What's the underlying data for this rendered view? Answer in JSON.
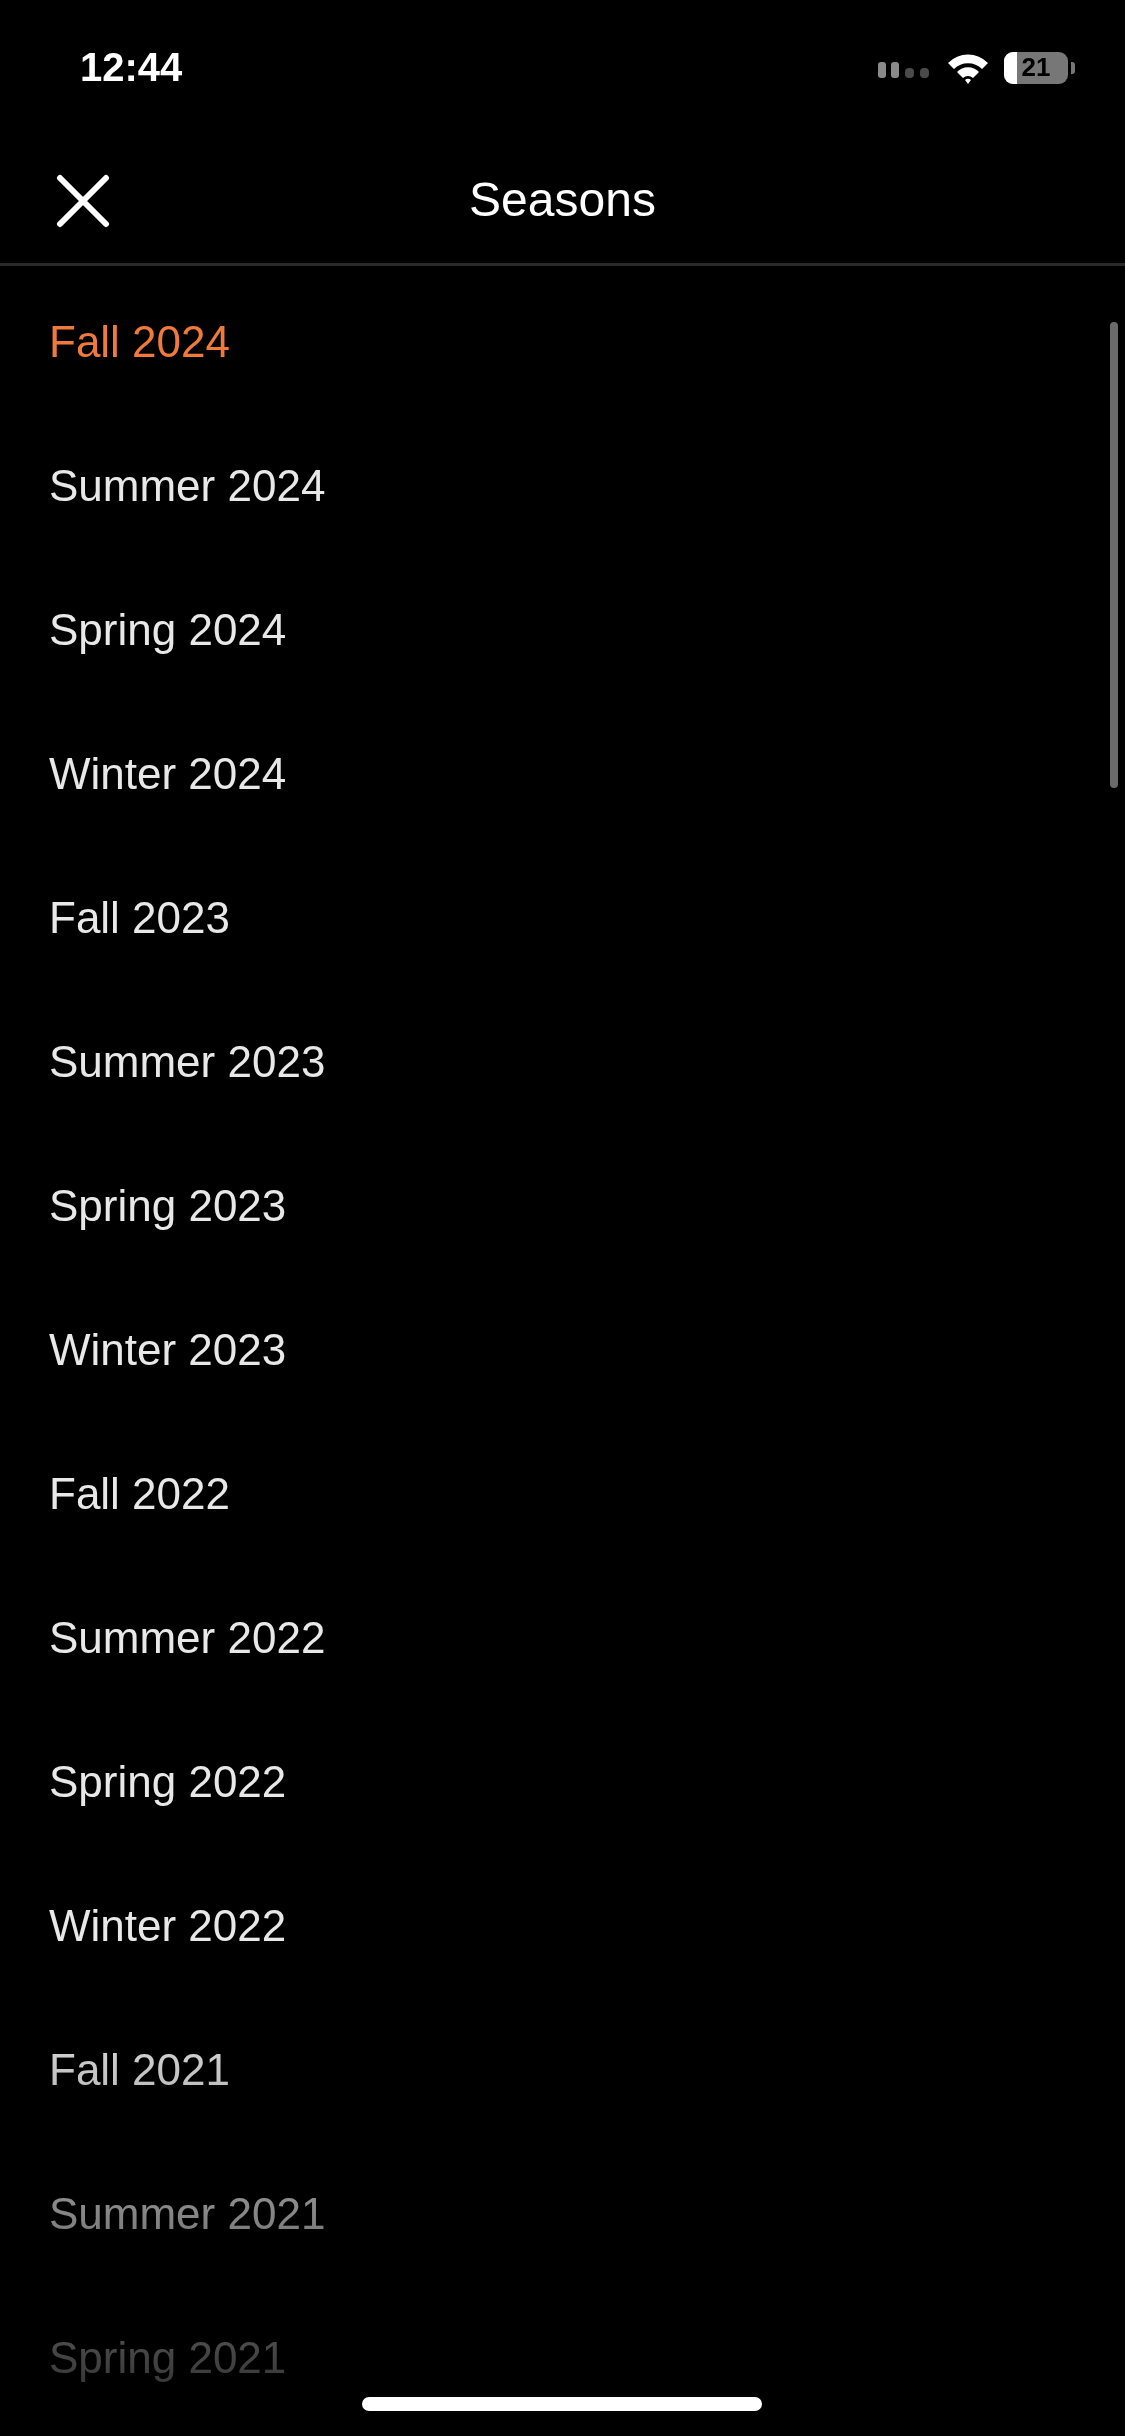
{
  "status_bar": {
    "time": "12:44",
    "battery": "21"
  },
  "header": {
    "title": "Seasons"
  },
  "seasons": [
    {
      "label": "Fall 2024",
      "selected": true
    },
    {
      "label": "Summer 2024",
      "selected": false
    },
    {
      "label": "Spring 2024",
      "selected": false
    },
    {
      "label": "Winter 2024",
      "selected": false
    },
    {
      "label": "Fall 2023",
      "selected": false
    },
    {
      "label": "Summer 2023",
      "selected": false
    },
    {
      "label": "Spring 2023",
      "selected": false
    },
    {
      "label": "Winter 2023",
      "selected": false
    },
    {
      "label": "Fall 2022",
      "selected": false
    },
    {
      "label": "Summer 2022",
      "selected": false
    },
    {
      "label": "Spring 2022",
      "selected": false
    },
    {
      "label": "Winter 2022",
      "selected": false
    },
    {
      "label": "Fall 2021",
      "selected": false
    },
    {
      "label": "Summer 2021",
      "selected": false
    },
    {
      "label": "Spring 2021",
      "selected": false
    }
  ]
}
